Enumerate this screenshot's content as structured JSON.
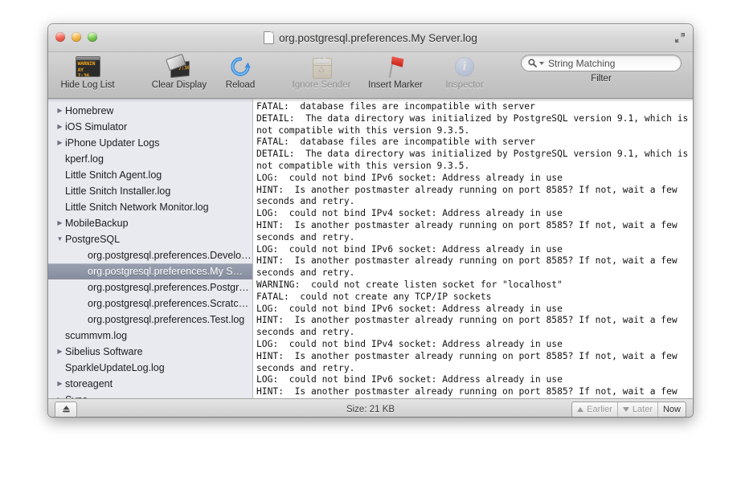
{
  "window": {
    "title": "org.postgresql.preferences.My Server.log",
    "doc_icon": "document-icon",
    "fullscreen_icon": "fullscreen-icon",
    "traffic": {
      "close": "close-button",
      "minimize": "minimize-button",
      "zoom": "zoom-button"
    }
  },
  "toolbar": {
    "items": [
      {
        "label": "Hide Log List",
        "icon": "console-icon",
        "disabled": false
      },
      {
        "label": "Clear Display",
        "icon": "clear-display-icon",
        "disabled": false
      },
      {
        "label": "Reload",
        "icon": "reload-icon",
        "disabled": false
      },
      {
        "label": "Ignore Sender",
        "icon": "paper-bag-icon",
        "disabled": true
      },
      {
        "label": "Insert Marker",
        "icon": "red-flag-icon",
        "disabled": false
      },
      {
        "label": "Inspector",
        "icon": "info-icon",
        "disabled": true
      }
    ],
    "console_icon_text_line1": "WARNIN",
    "console_icon_text_line2": "AY 7:36",
    "clear_icon_text": "7:36",
    "filter": {
      "value": "String Matching",
      "placeholder": "String Matching",
      "label": "Filter",
      "search_icon": "search-icon",
      "menu_icon": "chevron-down-icon"
    }
  },
  "sidebar": {
    "items": [
      {
        "label": "Homebrew",
        "arrow": "collapsed",
        "level": 0
      },
      {
        "label": "iOS Simulator",
        "arrow": "collapsed",
        "level": 0
      },
      {
        "label": "iPhone Updater Logs",
        "arrow": "collapsed",
        "level": 0
      },
      {
        "label": "kperf.log",
        "arrow": "none",
        "level": 0
      },
      {
        "label": "Little Snitch Agent.log",
        "arrow": "none",
        "level": 0
      },
      {
        "label": "Little Snitch Installer.log",
        "arrow": "none",
        "level": 0
      },
      {
        "label": "Little Snitch Network Monitor.log",
        "arrow": "none",
        "level": 0
      },
      {
        "label": "MobileBackup",
        "arrow": "collapsed",
        "level": 0
      },
      {
        "label": "PostgreSQL",
        "arrow": "expanded",
        "level": 0
      },
      {
        "label": "org.postgresql.preferences.Develo…",
        "arrow": "none",
        "level": 1
      },
      {
        "label": "org.postgresql.preferences.My S…",
        "arrow": "none",
        "level": 1,
        "selected": true
      },
      {
        "label": "org.postgresql.preferences.Postgre…",
        "arrow": "none",
        "level": 1
      },
      {
        "label": "org.postgresql.preferences.Scratch.log",
        "arrow": "none",
        "level": 1
      },
      {
        "label": "org.postgresql.preferences.Test.log",
        "arrow": "none",
        "level": 1
      },
      {
        "label": "scummvm.log",
        "arrow": "none",
        "level": 0
      },
      {
        "label": "Sibelius Software",
        "arrow": "collapsed",
        "level": 0
      },
      {
        "label": "SparkleUpdateLog.log",
        "arrow": "none",
        "level": 0
      },
      {
        "label": "storeagent",
        "arrow": "collapsed",
        "level": 0
      },
      {
        "label": "Sync",
        "arrow": "collapsed",
        "level": 0
      }
    ],
    "arrow_glyphs": {
      "collapsed": "▶",
      "expanded": "▼",
      "none": ""
    }
  },
  "log": {
    "text": "FATAL:  database files are incompatible with server\nDETAIL:  The data directory was initialized by PostgreSQL version 9.1, which is not compatible with this version 9.3.5.\nFATAL:  database files are incompatible with server\nDETAIL:  The data directory was initialized by PostgreSQL version 9.1, which is not compatible with this version 9.3.5.\nLOG:  could not bind IPv6 socket: Address already in use\nHINT:  Is another postmaster already running on port 8585? If not, wait a few seconds and retry.\nLOG:  could not bind IPv4 socket: Address already in use\nHINT:  Is another postmaster already running on port 8585? If not, wait a few seconds and retry.\nLOG:  could not bind IPv6 socket: Address already in use\nHINT:  Is another postmaster already running on port 8585? If not, wait a few seconds and retry.\nWARNING:  could not create listen socket for \"localhost\"\nFATAL:  could not create any TCP/IP sockets\nLOG:  could not bind IPv6 socket: Address already in use\nHINT:  Is another postmaster already running on port 8585? If not, wait a few seconds and retry.\nLOG:  could not bind IPv4 socket: Address already in use\nHINT:  Is another postmaster already running on port 8585? If not, wait a few seconds and retry.\nLOG:  could not bind IPv6 socket: Address already in use\nHINT:  Is another postmaster already running on port 8585? If not, wait a few seconds and retry.\nWARNING:  could not create listen socket for \"localhost\"\nFATAL:  could not create any TCP/IP sockets"
  },
  "statusbar": {
    "eject_icon": "eject-button",
    "size": "Size: 21 KB",
    "earlier": "Earlier",
    "later": "Later",
    "now": "Now"
  }
}
